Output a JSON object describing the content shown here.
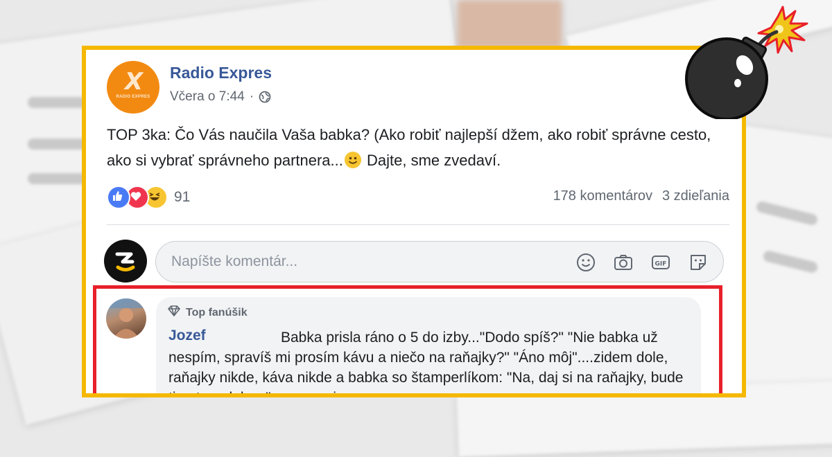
{
  "post": {
    "page_name": "Radio Expres",
    "logo_letter": "X",
    "logo_caption": "RADIO EXPRES",
    "timestamp": "Včera o 7:44",
    "separator": "·",
    "text_before_emoji": "TOP 3ka: Čo Vás naučila Vaša babka? (Ako robiť najlepší džem, ako robiť správne cesto, ako si vybrať správneho partnera...",
    "text_after_emoji": " Dajte, sme zvedaví.",
    "reaction_count": "91",
    "comments_count": "178 komentárov",
    "shares_count": "3 zdieľania"
  },
  "comment_input": {
    "placeholder": "Napíšte komentár..."
  },
  "top_comment": {
    "badge": "Top fanúšik",
    "author": "Jozef",
    "text": "Babka prisla ráno o 5 do izby...\"Dodo spíš?\" \"Nie babka už nespím, spravíš mi prosím kávu a niečo na raňajky?\" \"Áno môj\"....zidem dole, raňajky nikde, káva nikde a babka so štamperlíkom: \"Na, daj si na raňajky, bude ti potom dobre.\" ...vyzu mi"
  },
  "colors": {
    "frame": "#f5b800",
    "highlight": "#e8202a",
    "link": "#385898",
    "brand": "#f28a12"
  },
  "icons": [
    "globe-icon",
    "like-reaction-icon",
    "love-reaction-icon",
    "haha-reaction-icon",
    "smiley-icon",
    "camera-icon",
    "gif-icon",
    "sticker-icon",
    "diamond-icon",
    "bomb-icon"
  ]
}
